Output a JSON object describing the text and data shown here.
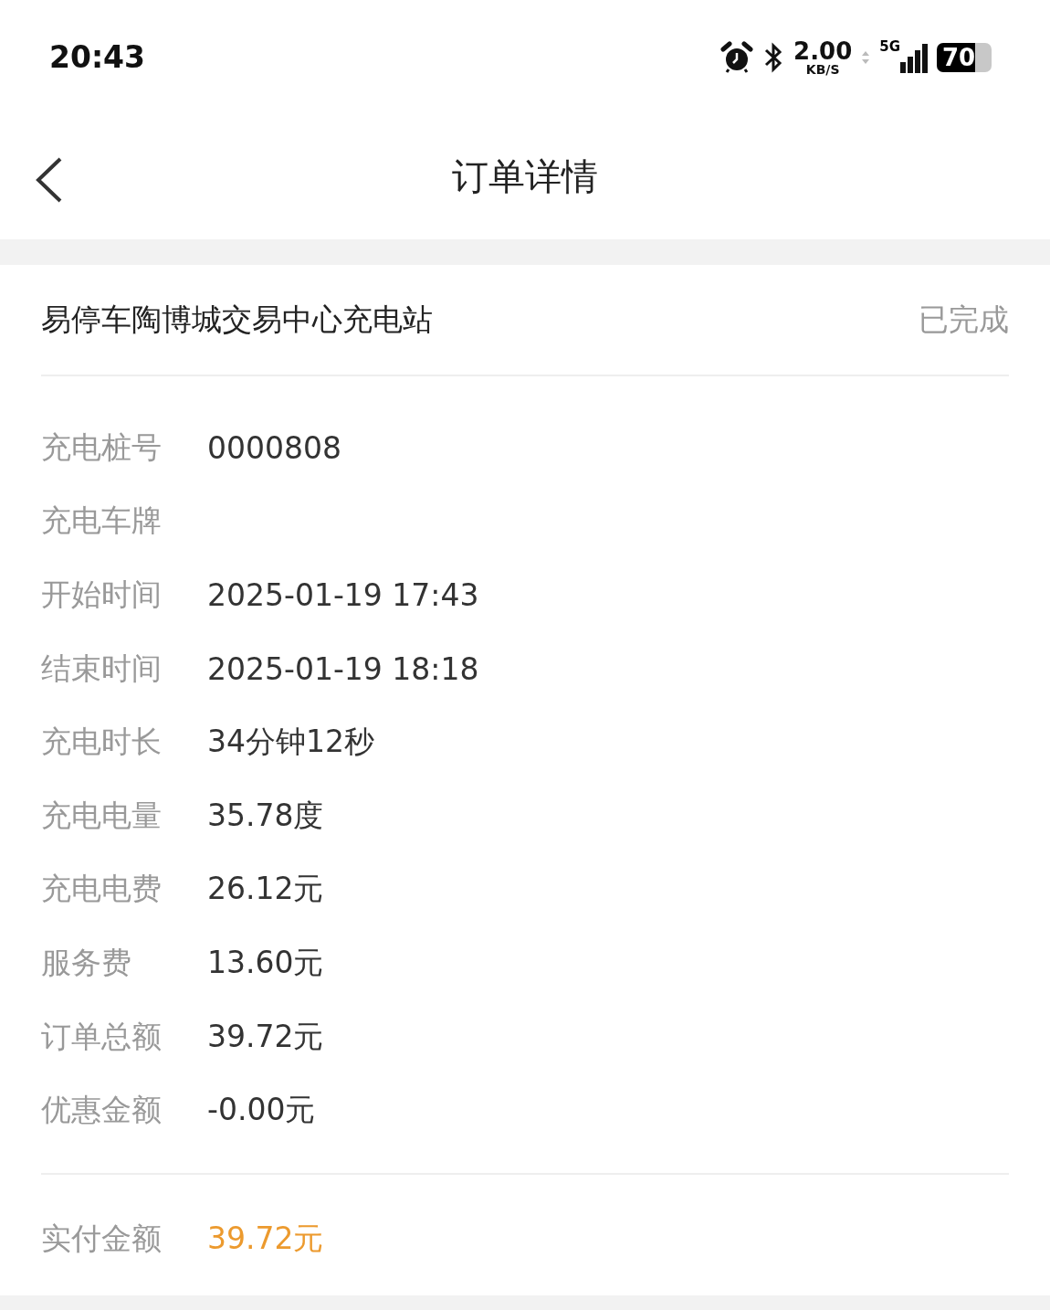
{
  "status_bar": {
    "time": "20:43",
    "speed": "2.00",
    "speed_unit": "KB/S",
    "network": "5G",
    "battery": "70"
  },
  "nav": {
    "title": "订单详情"
  },
  "order": {
    "station": "易停车陶博城交易中心充电站",
    "status": "已完成",
    "rows": [
      {
        "label": "充电桩号",
        "value": "0000808"
      },
      {
        "label": "充电车牌"
      },
      {
        "label": "开始时间",
        "value": "2025-01-19 17:43"
      },
      {
        "label": "结束时间",
        "value": "2025-01-19 18:18"
      },
      {
        "label": "充电时长",
        "value": "34分钟12秒"
      },
      {
        "label": "充电电量",
        "value": "35.78度"
      },
      {
        "label": "充电电费",
        "value": "26.12元"
      },
      {
        "label": "服务费",
        "value": "13.60元"
      },
      {
        "label": "订单总额",
        "value": "39.72元"
      },
      {
        "label": "优惠金额",
        "value": "-0.00元"
      }
    ],
    "paid": {
      "label": "实付金额",
      "value": "39.72元"
    }
  }
}
